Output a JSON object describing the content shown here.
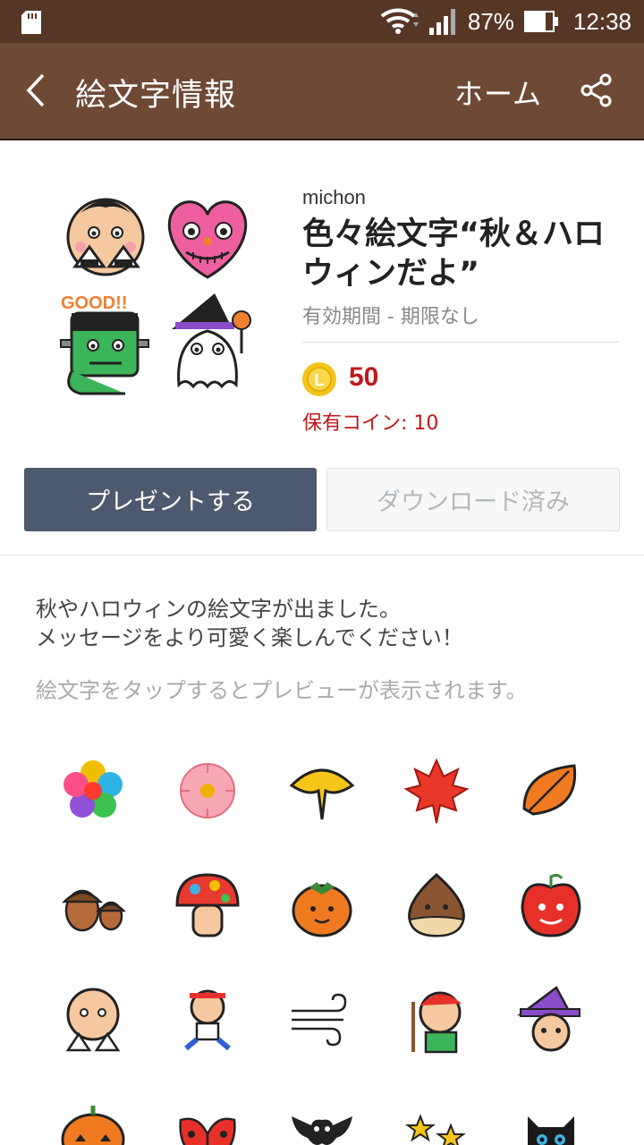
{
  "status_bar": {
    "battery": "87%",
    "time": "12:38"
  },
  "header": {
    "back_icon": "back-chevron-icon",
    "title": "絵文字情報",
    "home_label": "ホーム",
    "share_icon": "share-icon"
  },
  "product": {
    "author": "michon",
    "name": "色々絵文字“秋＆ハロウィンだよ”",
    "validity": "有効期間 - 期限なし",
    "price": "50",
    "coin_letter": "L",
    "owned_coins": "保有コイン: 10"
  },
  "buttons": {
    "gift": "プレゼントする",
    "downloaded": "ダウンロード済み"
  },
  "description": {
    "line1": "秋やハロウィンの絵文字が出ました。",
    "line2": "メッセージをより可愛く楽しんでください！",
    "hint": "絵文字をタップするとプレビューが表示されます。"
  },
  "colors": {
    "status_bar": "#563726",
    "header": "#6e4a36",
    "gift_button": "#4d596e",
    "price_red": "#c2181b",
    "coin_yellow": "#f3c41a"
  },
  "emoji_grid": [
    "flower-icon",
    "cherry-blossom-icon",
    "ginkgo-leaf-icon",
    "maple-leaf-icon",
    "leaf-icon",
    "acorn-icon",
    "mushroom-icon",
    "persimmon-icon",
    "chestnut-icon",
    "apple-icon",
    "onigiri-kid-icon",
    "running-kid-icon",
    "wind-icon",
    "painter-icon",
    "witch-icon",
    "pumpkin-icon",
    "ladybug-wings-icon",
    "bat-icon",
    "stars-icon",
    "black-cat-icon"
  ],
  "thumbnail": [
    "onigiri-kid-icon",
    "pink-heart-monster-icon",
    "frankenstein-icon",
    "ghost-witch-icon"
  ],
  "thumbnail_text": "GOOD!!"
}
